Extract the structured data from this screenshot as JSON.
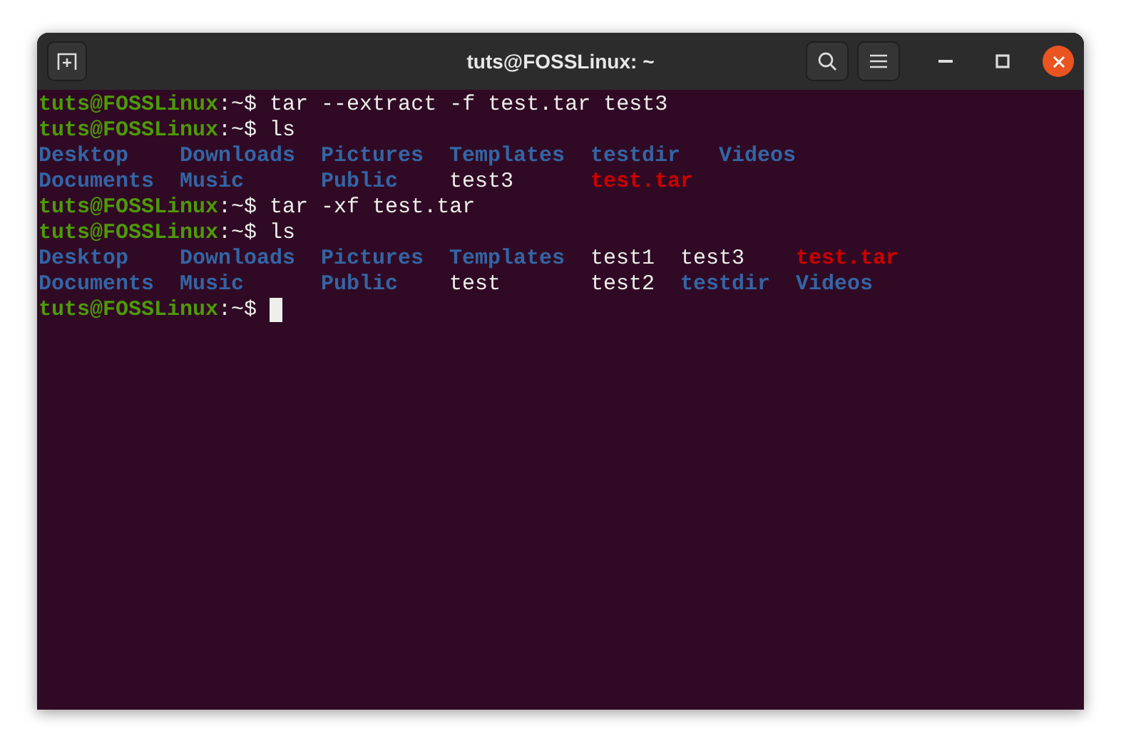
{
  "window": {
    "title": "tuts@FOSSLinux: ~"
  },
  "terminal": {
    "lines": [
      {
        "kind": "prompt",
        "prompt": "tuts@FOSSLinux",
        "path": ":~$",
        "command": "tar --extract -f test.tar test3"
      },
      {
        "kind": "prompt",
        "prompt": "tuts@FOSSLinux",
        "path": ":~$",
        "command": "ls"
      },
      {
        "kind": "listing",
        "columns": [
          [
            {
              "text": "Desktop",
              "kind": "dir"
            },
            {
              "text": "Documents",
              "kind": "dir"
            }
          ],
          [
            {
              "text": "Downloads",
              "kind": "dir"
            },
            {
              "text": "Music",
              "kind": "dir"
            }
          ],
          [
            {
              "text": "Pictures",
              "kind": "dir"
            },
            {
              "text": "Public",
              "kind": "dir"
            }
          ],
          [
            {
              "text": "Templates",
              "kind": "dir"
            },
            {
              "text": "test3",
              "kind": "file"
            }
          ],
          [
            {
              "text": "testdir",
              "kind": "dir"
            },
            {
              "text": "test.tar",
              "kind": "archive"
            }
          ],
          [
            {
              "text": "Videos",
              "kind": "dir"
            }
          ]
        ]
      },
      {
        "kind": "prompt",
        "prompt": "tuts@FOSSLinux",
        "path": ":~$",
        "command": "tar -xf test.tar"
      },
      {
        "kind": "prompt",
        "prompt": "tuts@FOSSLinux",
        "path": ":~$",
        "command": "ls"
      },
      {
        "kind": "listing",
        "columns": [
          [
            {
              "text": "Desktop",
              "kind": "dir"
            },
            {
              "text": "Documents",
              "kind": "dir"
            }
          ],
          [
            {
              "text": "Downloads",
              "kind": "dir"
            },
            {
              "text": "Music",
              "kind": "dir"
            }
          ],
          [
            {
              "text": "Pictures",
              "kind": "dir"
            },
            {
              "text": "Public",
              "kind": "dir"
            }
          ],
          [
            {
              "text": "Templates",
              "kind": "dir"
            },
            {
              "text": "test",
              "kind": "file"
            }
          ],
          [
            {
              "text": "test1",
              "kind": "file"
            },
            {
              "text": "test2",
              "kind": "file"
            }
          ],
          [
            {
              "text": "test3",
              "kind": "file"
            },
            {
              "text": "testdir",
              "kind": "dir"
            }
          ],
          [
            {
              "text": "test.tar",
              "kind": "archive"
            },
            {
              "text": "Videos",
              "kind": "dir"
            }
          ]
        ]
      },
      {
        "kind": "prompt",
        "prompt": "tuts@FOSSLinux",
        "path": ":~$",
        "cursor": true
      }
    ]
  }
}
